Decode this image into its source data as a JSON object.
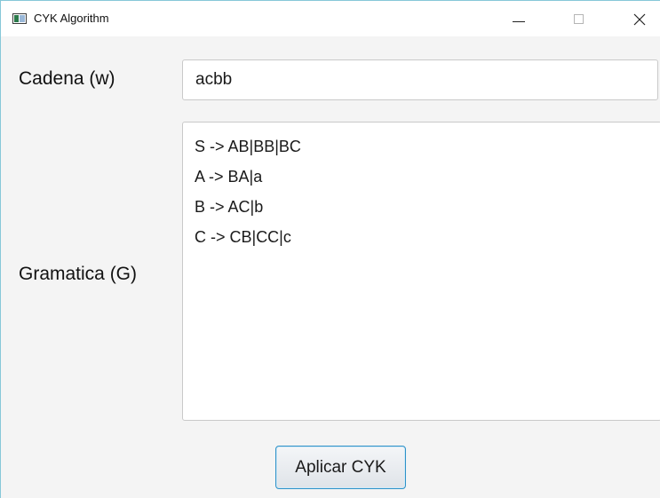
{
  "window": {
    "title": "CYK Algorithm",
    "controls": {
      "minimize": "minimize-icon",
      "maximize": "maximize-icon",
      "close": "close-icon"
    }
  },
  "form": {
    "string_label": "Cadena (w)",
    "string_value": "acbb",
    "grammar_label": "Gramatica (G)",
    "grammar_lines": [
      "S -> AB|BB|BC",
      "A -> BA|a",
      "B -> AC|b",
      "C -> CB|CC|c"
    ],
    "apply_button": "Aplicar CYK"
  },
  "colors": {
    "window_background": "#f4f4f4",
    "titlebar_background": "#ffffff",
    "button_focus_border": "#2f92c8"
  }
}
